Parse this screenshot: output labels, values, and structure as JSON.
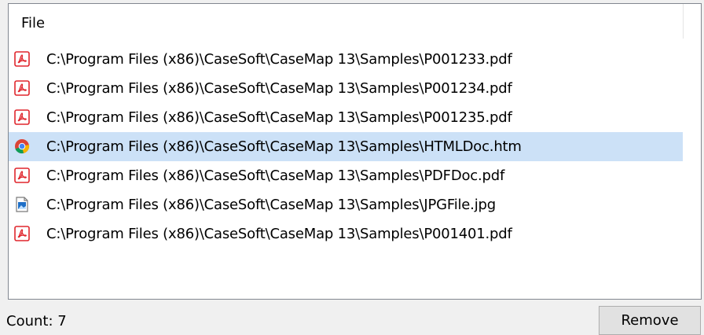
{
  "list": {
    "column_header": "File",
    "items": [
      {
        "path": "C:\\Program Files (x86)\\CaseSoft\\CaseMap 13\\Samples\\P001233.pdf",
        "icon": "pdf-icon",
        "selected": false
      },
      {
        "path": "C:\\Program Files (x86)\\CaseSoft\\CaseMap 13\\Samples\\P001234.pdf",
        "icon": "pdf-icon",
        "selected": false
      },
      {
        "path": "C:\\Program Files (x86)\\CaseSoft\\CaseMap 13\\Samples\\P001235.pdf",
        "icon": "pdf-icon",
        "selected": false
      },
      {
        "path": "C:\\Program Files (x86)\\CaseSoft\\CaseMap 13\\Samples\\HTMLDoc.htm",
        "icon": "chrome-icon",
        "selected": true
      },
      {
        "path": "C:\\Program Files (x86)\\CaseSoft\\CaseMap 13\\Samples\\PDFDoc.pdf",
        "icon": "pdf-icon",
        "selected": false
      },
      {
        "path": "C:\\Program Files (x86)\\CaseSoft\\CaseMap 13\\Samples\\JPGFile.jpg",
        "icon": "image-file-icon",
        "selected": false
      },
      {
        "path": "C:\\Program Files (x86)\\CaseSoft\\CaseMap 13\\Samples\\P001401.pdf",
        "icon": "pdf-icon",
        "selected": false
      }
    ]
  },
  "footer": {
    "count_label": "Count: 7",
    "remove_label": "Remove"
  },
  "colors": {
    "selection": "#cce1f7",
    "pdf_red": "#e0262d",
    "button_bg": "#e1e1e1"
  }
}
